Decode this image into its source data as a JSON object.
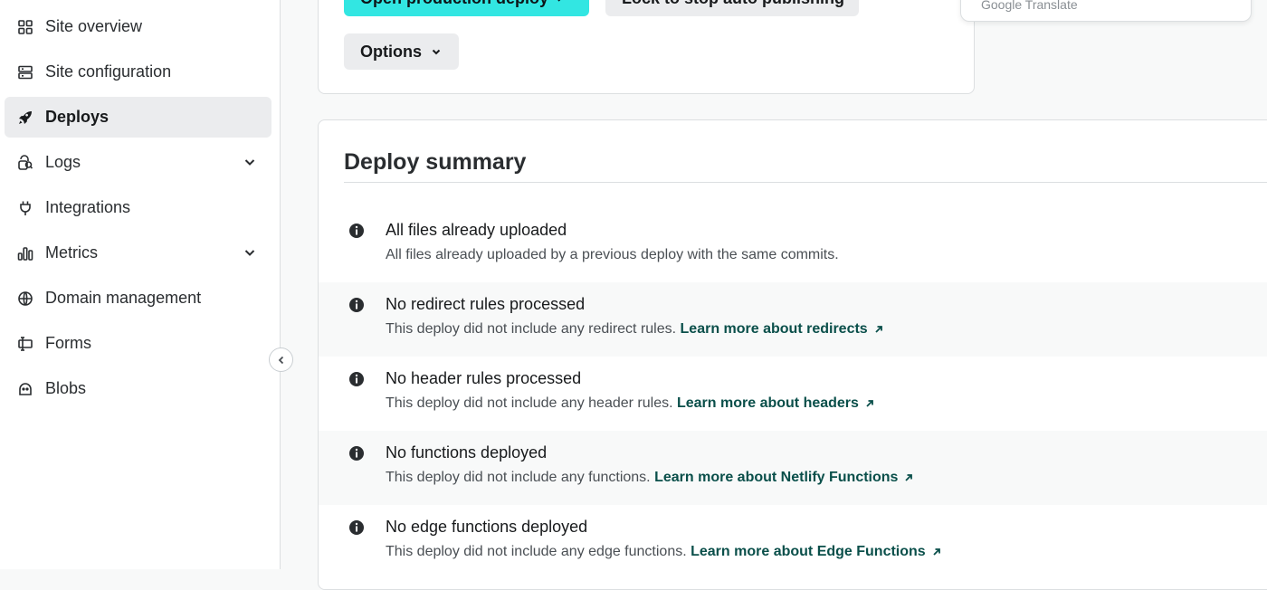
{
  "sidebar": {
    "items": [
      {
        "label": "Site overview",
        "icon": "grid-icon"
      },
      {
        "label": "Site configuration",
        "icon": "server-icon"
      },
      {
        "label": "Deploys",
        "icon": "rocket-icon",
        "active": true
      },
      {
        "label": "Logs",
        "icon": "logs-icon",
        "has_chevron": true
      },
      {
        "label": "Integrations",
        "icon": "plug-icon"
      },
      {
        "label": "Metrics",
        "icon": "bar-chart-icon",
        "has_chevron": true
      },
      {
        "label": "Domain management",
        "icon": "globe-icon"
      },
      {
        "label": "Forms",
        "icon": "forms-icon"
      },
      {
        "label": "Blobs",
        "icon": "blobs-icon"
      }
    ]
  },
  "top_card": {
    "primary_button": "Open production deploy",
    "secondary_button": "Lock to stop auto publishing",
    "options_button": "Options"
  },
  "popover": {
    "text": "Google Translate"
  },
  "summary": {
    "title": "Deploy summary",
    "rows": [
      {
        "title": "All files already uploaded",
        "description": "All files already uploaded by a previous deploy with the same commits.",
        "link": ""
      },
      {
        "title": "No redirect rules processed",
        "description": "This deploy did not include any redirect rules. ",
        "link": "Learn more about redirects"
      },
      {
        "title": "No header rules processed",
        "description": "This deploy did not include any header rules. ",
        "link": "Learn more about headers"
      },
      {
        "title": "No functions deployed",
        "description": "This deploy did not include any functions. ",
        "link": "Learn more about Netlify Functions"
      },
      {
        "title": "No edge functions deployed",
        "description": "This deploy did not include any edge functions. ",
        "link": "Learn more about Edge Functions"
      }
    ]
  }
}
